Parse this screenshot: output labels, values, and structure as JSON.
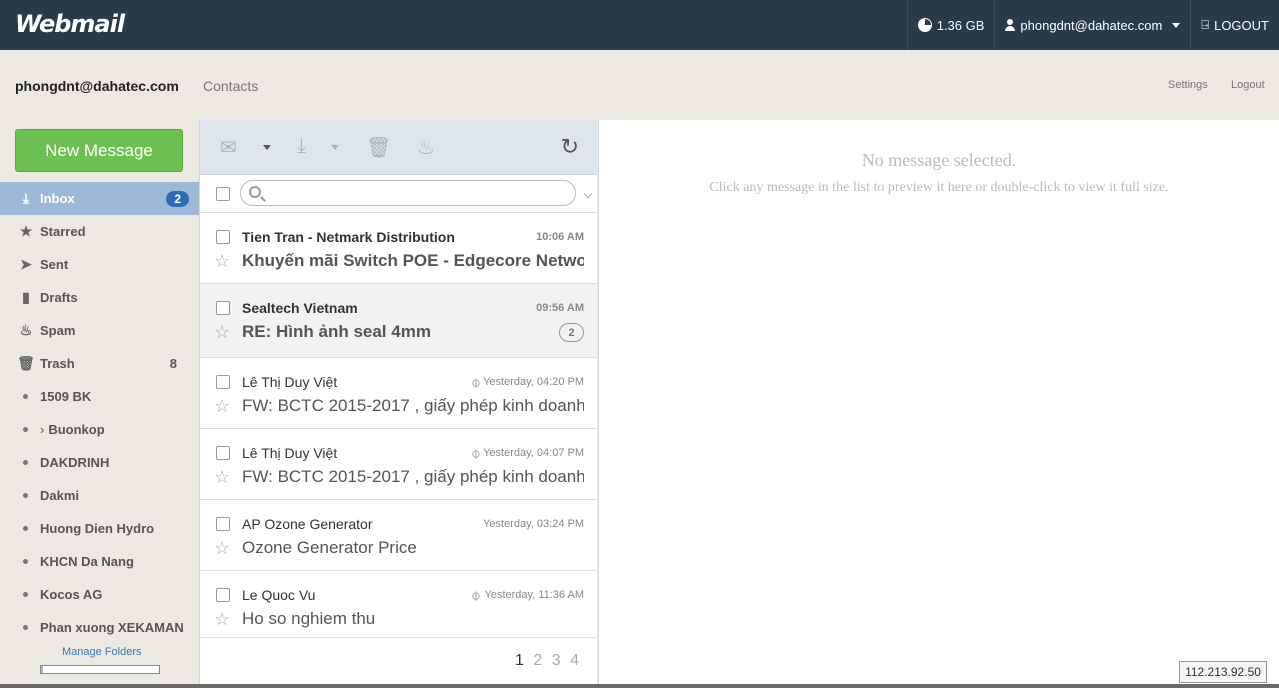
{
  "header": {
    "logo": "Webmail",
    "quota": "1.36 GB",
    "user": "phongdnt@dahatec.com",
    "logout": "LOGOUT"
  },
  "subheader": {
    "account": "phongdnt@dahatec.com",
    "contacts": "Contacts",
    "settings": "Settings",
    "logout": "Logout"
  },
  "sidebar": {
    "new_message": "New Message",
    "folders": [
      {
        "label": "Inbox",
        "badge": "2",
        "icon": "inbox-icon"
      },
      {
        "label": "Starred",
        "icon": "star-icon"
      },
      {
        "label": "Sent",
        "icon": "paper-plane-icon"
      },
      {
        "label": "Drafts",
        "icon": "drafts-icon"
      },
      {
        "label": "Spam",
        "icon": "fire-icon"
      },
      {
        "label": "Trash",
        "count": "8",
        "icon": "trash-icon"
      },
      {
        "label": "1509 BK"
      },
      {
        "label": "Buonkop",
        "expandable": true
      },
      {
        "label": "DAKDRINH"
      },
      {
        "label": "Dakmi"
      },
      {
        "label": "Huong Dien Hydro"
      },
      {
        "label": "KHCN Da Nang"
      },
      {
        "label": "Kocos AG"
      },
      {
        "label": "Phan xuong XEKAMAN"
      }
    ],
    "manage_folders": "Manage Folders",
    "quota_fraction": 0.02
  },
  "search": {
    "placeholder": ""
  },
  "messages": [
    {
      "from": "Tien Tran - Netmark Distribution",
      "time": "10:06 AM",
      "subject": "Khuyến mãi Switch POE - Edgecore Networks",
      "unread": true,
      "attachment": false
    },
    {
      "from": "Sealtech Vietnam",
      "time": "09:56 AM",
      "subject": "RE: Hình ảnh seal 4mm",
      "unread": true,
      "attachment": false,
      "thread_count": "2"
    },
    {
      "from": "Lê Thị Duy Việt",
      "time": "Yesterday, 04:20 PM",
      "subject": "FW: BCTC 2015-2017 , giấy phép kinh doanh",
      "unread": false,
      "attachment": true
    },
    {
      "from": "Lê Thị Duy Việt",
      "time": "Yesterday, 04:07 PM",
      "subject": "FW: BCTC 2015-2017 , giấy phép kinh doanh",
      "unread": false,
      "attachment": true
    },
    {
      "from": "AP Ozone Generator",
      "time": "Yesterday, 03:24 PM",
      "subject": "Ozone Generator Price",
      "unread": false,
      "attachment": false
    },
    {
      "from": "Le Quoc Vu",
      "time": "Yesterday, 11:36 AM",
      "subject": "Ho so nghiem thu",
      "unread": false,
      "attachment": true
    }
  ],
  "pager": {
    "pages": [
      "1",
      "2",
      "3",
      "4"
    ],
    "current": "1"
  },
  "preview": {
    "title": "No message selected.",
    "hint": "Click any message in the list to preview it here or double-click to view it full size."
  },
  "ip": "112.213.92.50"
}
